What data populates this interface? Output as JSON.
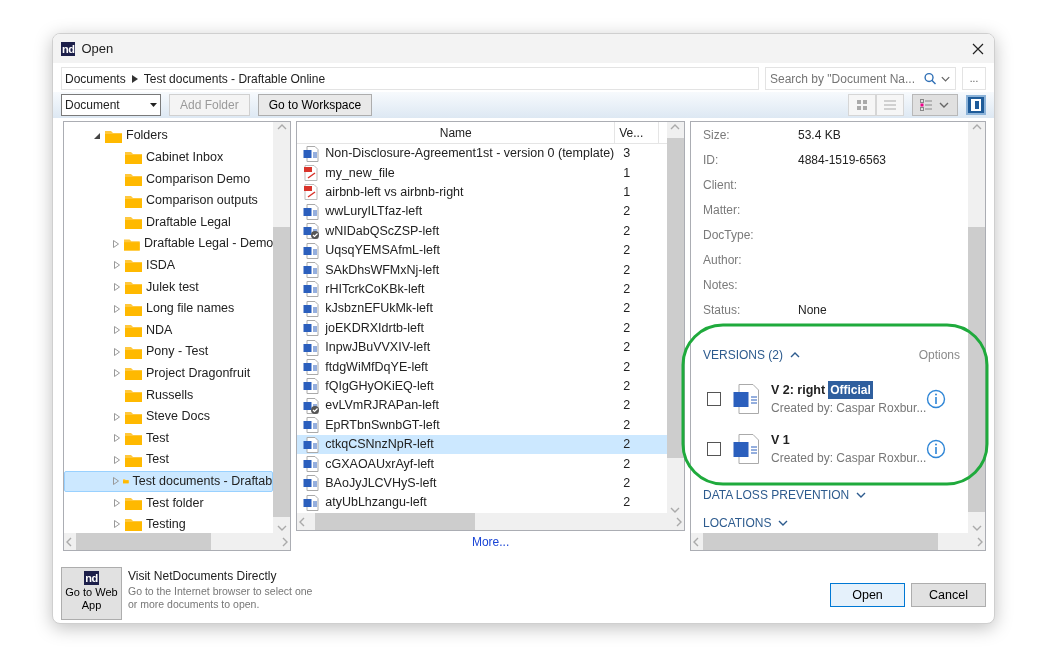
{
  "window": {
    "logo": "nd",
    "title": "Open"
  },
  "breadcrumb": [
    {
      "label": "Documents"
    },
    {
      "label": "Test documents - Draftable Online"
    }
  ],
  "search": {
    "placeholder": "Search by \"Document Na..."
  },
  "more_button": "...",
  "toolbar": {
    "type_select": "Document",
    "buttons": [
      {
        "label": "Add Folder",
        "disabled": true
      },
      {
        "label": "Go to Workspace",
        "disabled": false
      }
    ],
    "views": [
      {
        "kind": "tiles",
        "selected": false
      },
      {
        "kind": "list",
        "selected": false
      },
      {
        "kind": "details",
        "selected": true
      }
    ],
    "preview_pane": {
      "on": true
    }
  },
  "tree": {
    "items": [
      {
        "label": "Folders",
        "expanded": true,
        "children": [
          {
            "label": "Cabinet Inbox",
            "expandable": false,
            "selected": false
          },
          {
            "label": "Comparison Demo",
            "expandable": false,
            "selected": false
          },
          {
            "label": "Comparison outputs",
            "expandable": false,
            "selected": false
          },
          {
            "label": "Draftable Legal",
            "expandable": false,
            "selected": false
          },
          {
            "label": "Draftable Legal - Demo",
            "expandable": true,
            "selected": false
          },
          {
            "label": "ISDA",
            "expandable": true,
            "selected": false
          },
          {
            "label": "Julek test",
            "expandable": true,
            "selected": false
          },
          {
            "label": "Long file names",
            "expandable": true,
            "selected": false
          },
          {
            "label": "NDA",
            "expandable": true,
            "selected": false
          },
          {
            "label": "Pony - Test",
            "expandable": true,
            "selected": false
          },
          {
            "label": "Project Dragonfruit",
            "expandable": true,
            "selected": false
          },
          {
            "label": "Russells",
            "expandable": false,
            "selected": false
          },
          {
            "label": "Steve Docs",
            "expandable": true,
            "selected": false
          },
          {
            "label": "Test",
            "expandable": true,
            "selected": false
          },
          {
            "label": "Test",
            "expandable": true,
            "selected": false
          },
          {
            "label": "Test documents - Draftab",
            "expandable": true,
            "selected": true
          },
          {
            "label": "Test folder",
            "expandable": true,
            "selected": false
          },
          {
            "label": "Testing",
            "expandable": true,
            "selected": false
          }
        ]
      }
    ]
  },
  "files": {
    "columns": [
      "Name",
      "Ve..."
    ],
    "rows": [
      {
        "name": "Non-Disclosure-Agreement1st - version 0 (template)",
        "version": "3",
        "kind": "word",
        "selected": false
      },
      {
        "name": "my_new_file",
        "version": "1",
        "kind": "pdf",
        "selected": false
      },
      {
        "name": "airbnb-left vs airbnb-right",
        "version": "1",
        "kind": "pdf",
        "selected": false
      },
      {
        "name": "wwLuryILTfaz-left",
        "version": "2",
        "kind": "word",
        "selected": false
      },
      {
        "name": "wNIDabQScZSP-left",
        "version": "2",
        "kind": "word-checked",
        "selected": false
      },
      {
        "name": "UqsqYEMSAfmL-left",
        "version": "2",
        "kind": "word",
        "selected": false
      },
      {
        "name": "SAkDhsWFMxNj-left",
        "version": "2",
        "kind": "word",
        "selected": false
      },
      {
        "name": "rHITcrkCoKBk-left",
        "version": "2",
        "kind": "word",
        "selected": false
      },
      {
        "name": "kJsbznEFUkMk-left",
        "version": "2",
        "kind": "word",
        "selected": false
      },
      {
        "name": "joEKDRXIdrtb-left",
        "version": "2",
        "kind": "word",
        "selected": false
      },
      {
        "name": "InpwJBuVVXIV-left",
        "version": "2",
        "kind": "word",
        "selected": false
      },
      {
        "name": "ftdgWiMfDqYE-left",
        "version": "2",
        "kind": "word",
        "selected": false
      },
      {
        "name": "fQIgGHyOKiEQ-left",
        "version": "2",
        "kind": "word",
        "selected": false
      },
      {
        "name": "evLVmRJRAPan-left",
        "version": "2",
        "kind": "word-checked",
        "selected": false
      },
      {
        "name": "EpRTbnSwnbGT-left",
        "version": "2",
        "kind": "word",
        "selected": false
      },
      {
        "name": "ctkqCSNnzNpR-left",
        "version": "2",
        "kind": "word",
        "selected": true
      },
      {
        "name": "cGXAOAUxrAyf-left",
        "version": "2",
        "kind": "word",
        "selected": false
      },
      {
        "name": "BAoJyJLCVHyS-left",
        "version": "2",
        "kind": "word",
        "selected": false
      },
      {
        "name": "atyUbLhzangu-left",
        "version": "2",
        "kind": "word",
        "selected": false
      }
    ],
    "more_link": "More..."
  },
  "details": {
    "fields": [
      {
        "label": "Size:",
        "value": "53.4 KB"
      },
      {
        "label": "ID:",
        "value": "4884-1519-6563"
      },
      {
        "label": "Client:"
      },
      {
        "label": "Matter:"
      },
      {
        "label": "DocType:"
      },
      {
        "label": "Author:"
      },
      {
        "label": "Notes:"
      },
      {
        "label": "Status:",
        "value": "None"
      }
    ],
    "versions": {
      "title": "VERSIONS (2)",
      "expanded": true,
      "options": "Options",
      "items": [
        {
          "title": "V 2: right",
          "badge": "Official",
          "created": "Created by: Caspar Roxbur...",
          "checked": false
        },
        {
          "title": "V 1",
          "created": "Created by: Caspar Roxbur...",
          "checked": false
        }
      ]
    },
    "sections": [
      {
        "title": "DATA LOSS PREVENTION",
        "expanded": false
      },
      {
        "title": "LOCATIONS",
        "expanded": false
      }
    ]
  },
  "footer": {
    "web_app": {
      "logo": "nd",
      "label": "Go to Web App"
    },
    "heading": "Visit NetDocuments Directly",
    "description": "Go to the Internet browser to select one or more documents to open.",
    "buttons": [
      {
        "label": "Open",
        "default": true
      },
      {
        "label": "Cancel",
        "default": false
      }
    ]
  }
}
